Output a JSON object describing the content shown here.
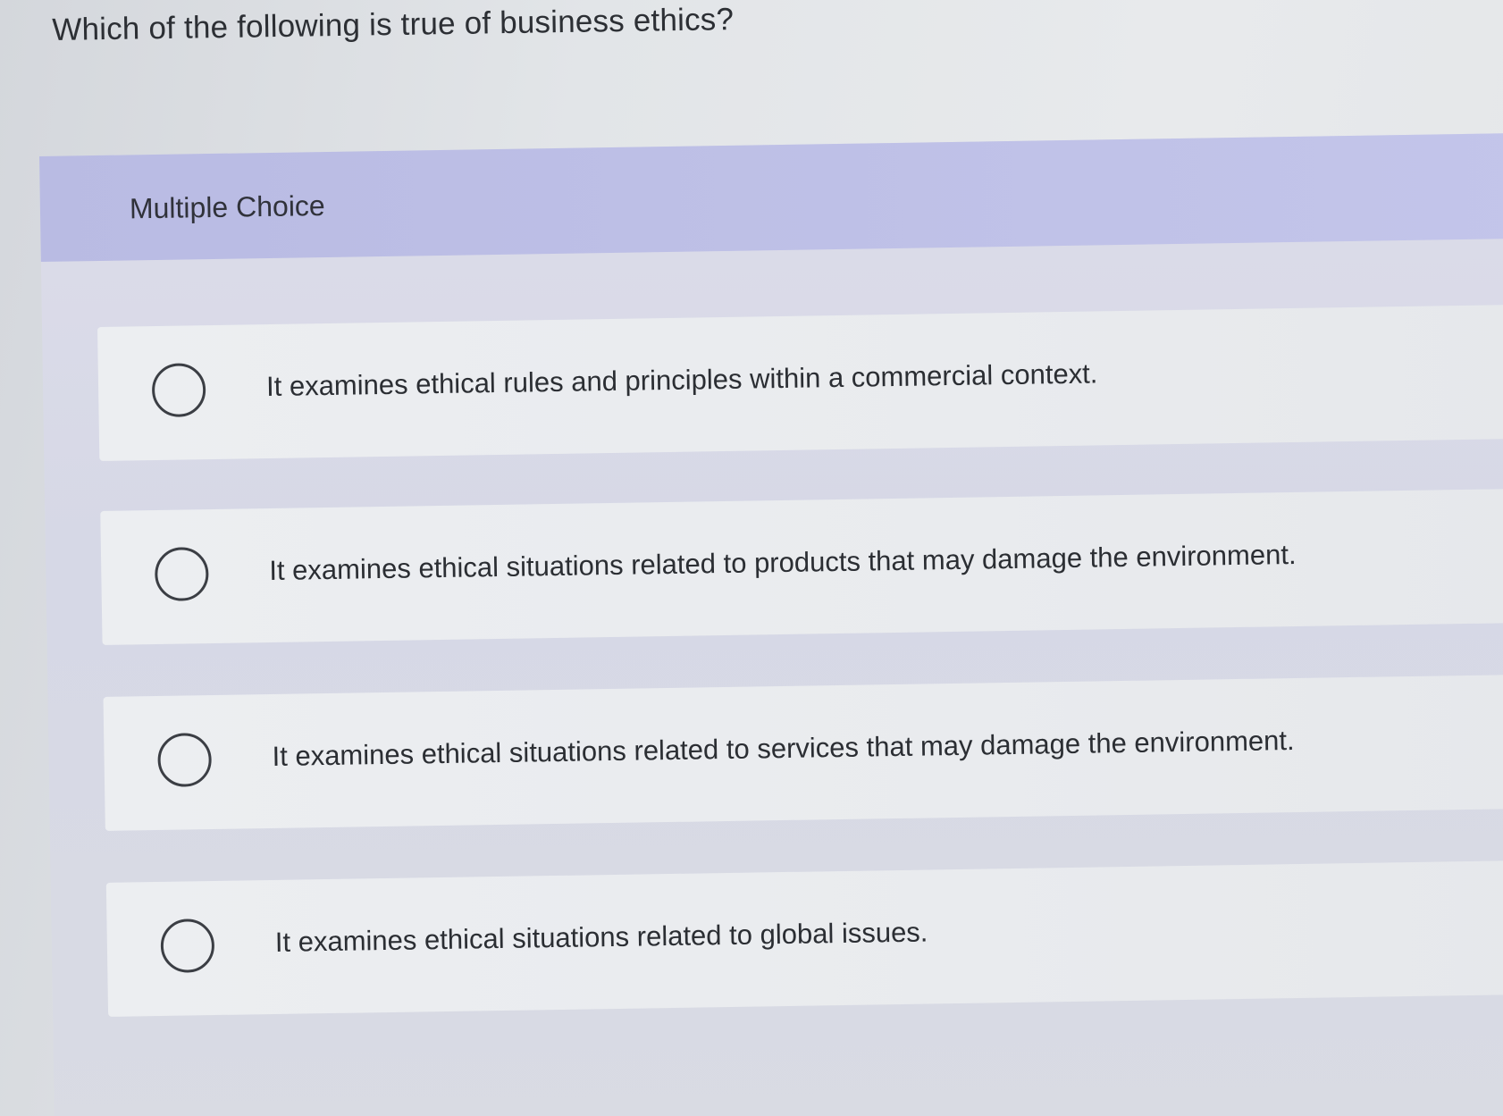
{
  "question": {
    "text": "Which of the following is true of business ethics?"
  },
  "multiple_choice": {
    "label": "Multiple Choice",
    "options": [
      {
        "text": "It examines ethical rules and principles within a commercial context."
      },
      {
        "text": "It examines ethical situations related to products that may damage the environment."
      },
      {
        "text": "It examines ethical situations related to services that may damage the environment."
      },
      {
        "text": "It examines ethical situations related to global issues."
      }
    ]
  }
}
